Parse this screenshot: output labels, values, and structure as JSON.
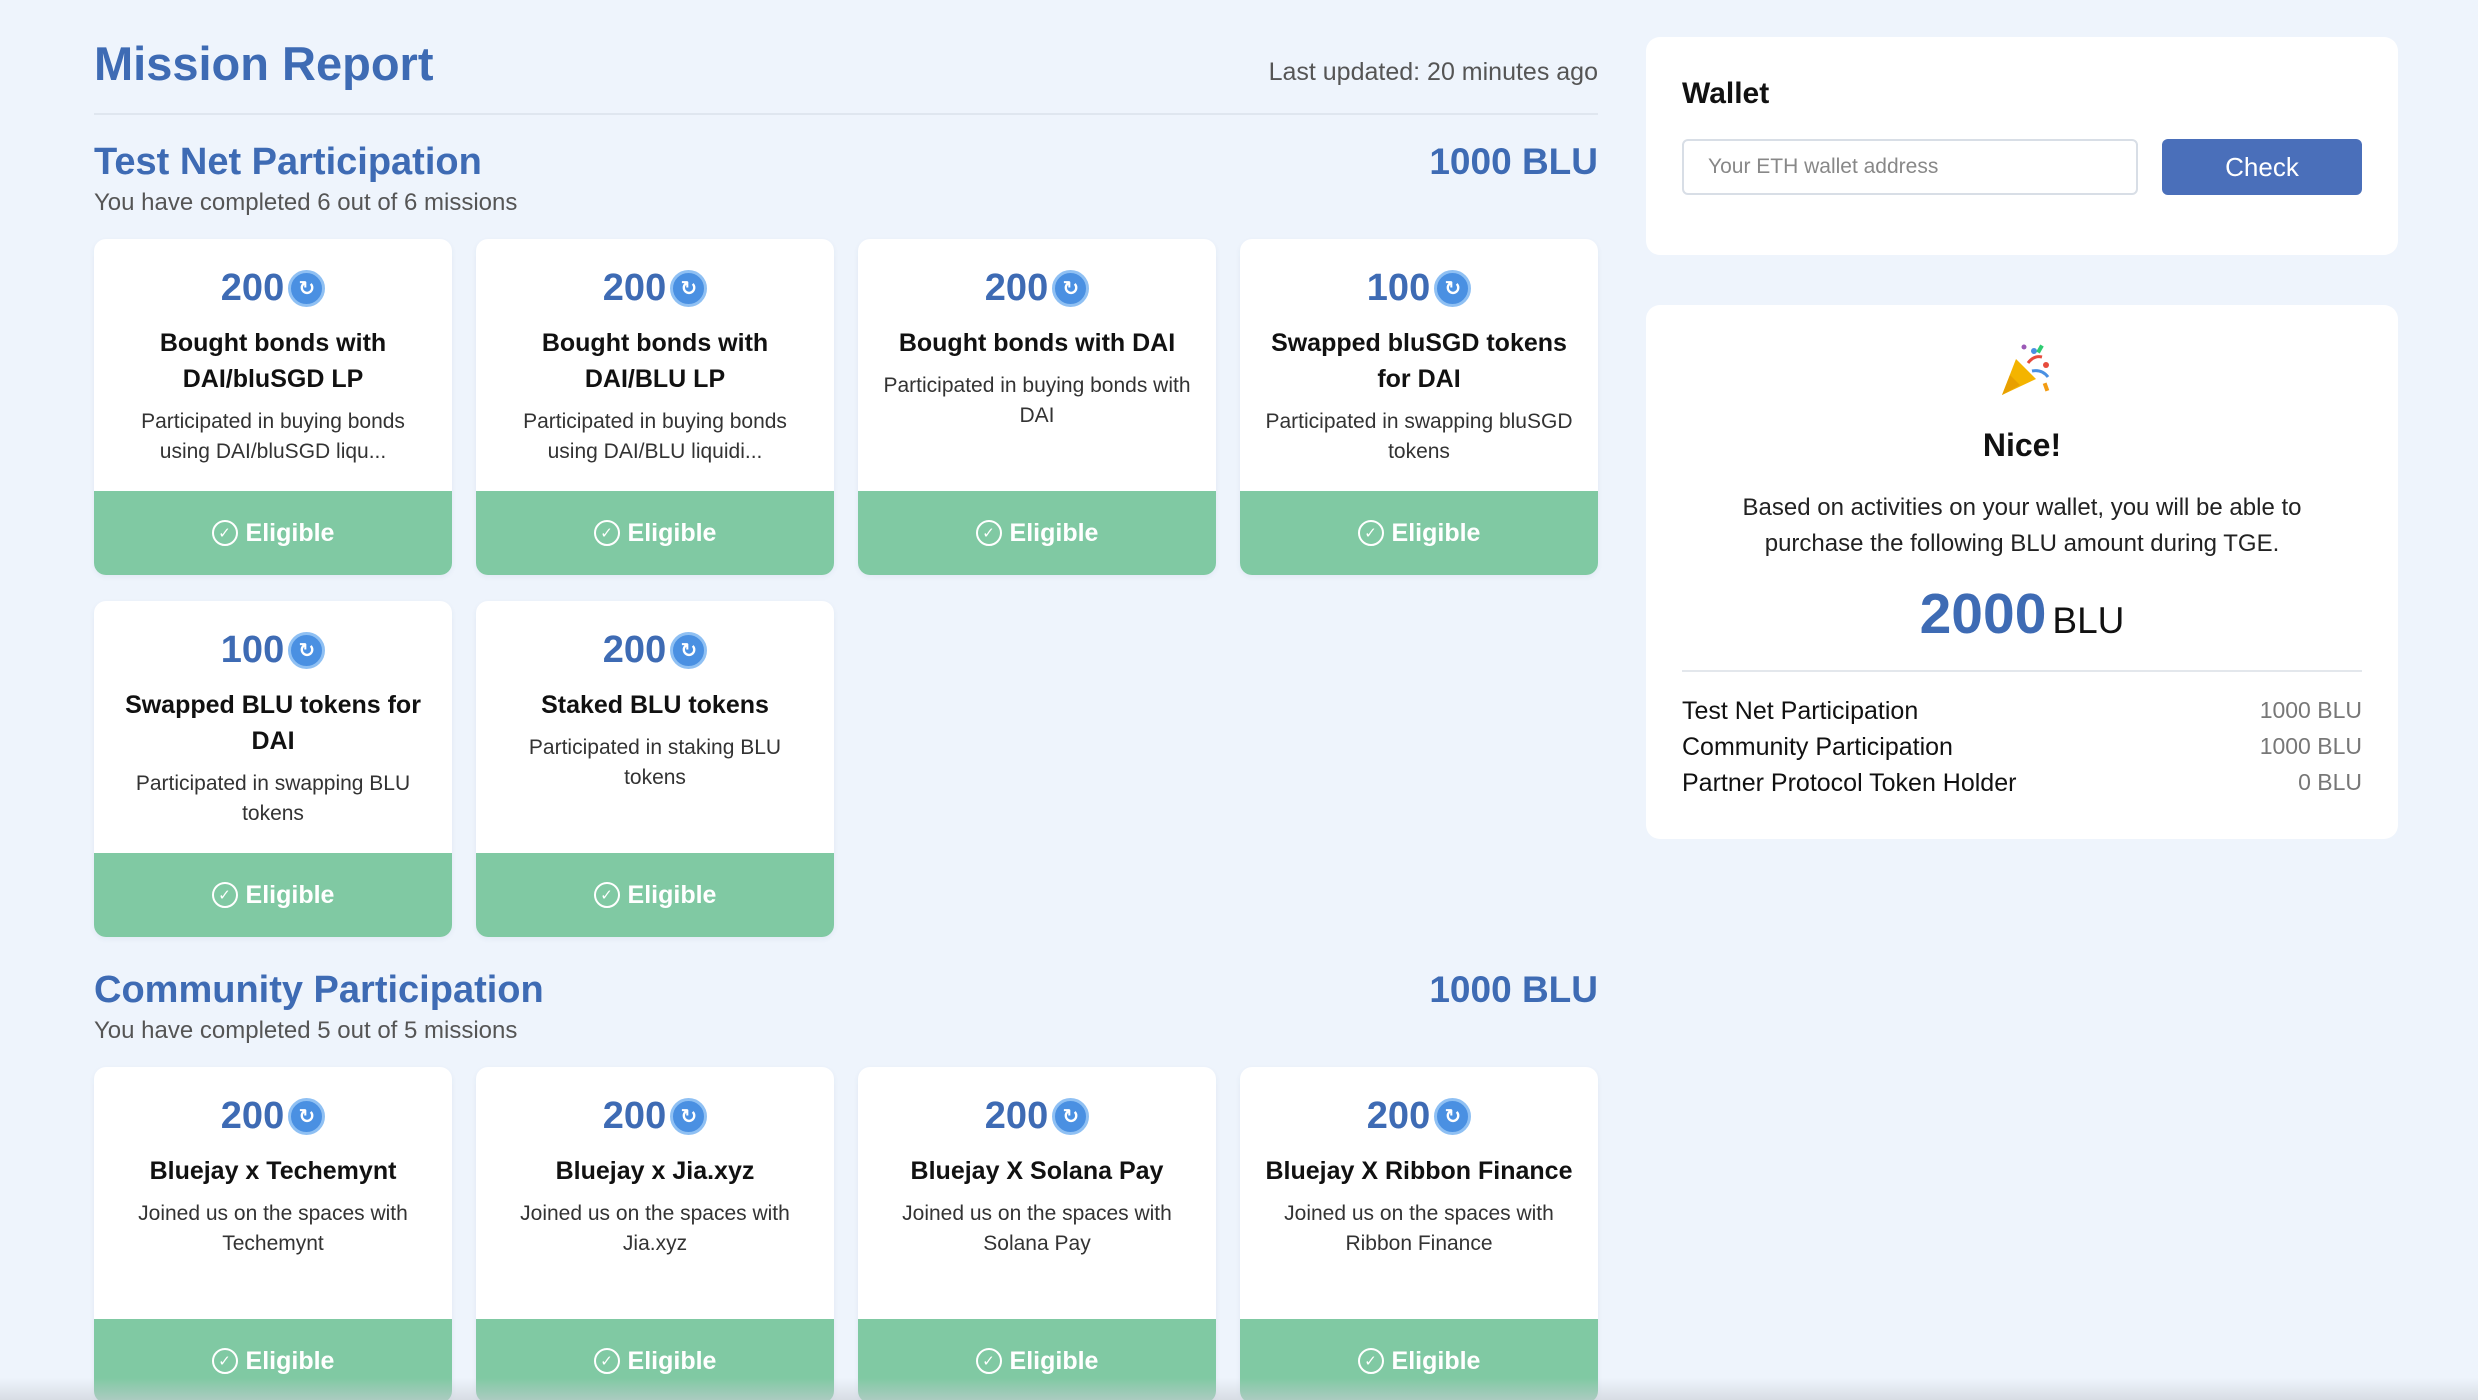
{
  "header": {
    "title": "Mission Report",
    "last_updated": "Last updated: 20 minutes ago"
  },
  "sections": [
    {
      "title": "Test Net Participation",
      "total": "1000 BLU",
      "subtitle": "You have completed 6 out of 6 missions",
      "missions": [
        {
          "points": "200",
          "title": "Bought bonds with DAI/bluSGD LP",
          "desc": "Participated in buying bonds using DAI/bluSGD liqu...",
          "status": "Eligible"
        },
        {
          "points": "200",
          "title": "Bought bonds with DAI/BLU LP",
          "desc": "Participated in buying bonds using DAI/BLU liquidi...",
          "status": "Eligible"
        },
        {
          "points": "200",
          "title": "Bought bonds with DAI",
          "desc": "Participated in buying bonds with DAI",
          "status": "Eligible"
        },
        {
          "points": "100",
          "title": "Swapped bluSGD tokens for DAI",
          "desc": "Participated in swapping bluSGD tokens",
          "status": "Eligible"
        },
        {
          "points": "100",
          "title": "Swapped BLU tokens for DAI",
          "desc": "Participated in swapping BLU tokens",
          "status": "Eligible"
        },
        {
          "points": "200",
          "title": "Staked BLU tokens",
          "desc": "Participated in staking BLU tokens",
          "status": "Eligible"
        }
      ]
    },
    {
      "title": "Community Participation",
      "total": "1000 BLU",
      "subtitle": "You have completed 5 out of 5 missions",
      "missions": [
        {
          "points": "200",
          "title": "Bluejay x Techemynt",
          "desc": "Joined us on the spaces with Techemynt",
          "status": "Eligible"
        },
        {
          "points": "200",
          "title": "Bluejay x Jia.xyz",
          "desc": "Joined us on the spaces with Jia.xyz",
          "status": "Eligible"
        },
        {
          "points": "200",
          "title": "Bluejay X Solana Pay",
          "desc": "Joined us on the spaces with Solana Pay",
          "status": "Eligible"
        },
        {
          "points": "200",
          "title": "Bluejay X Ribbon Finance",
          "desc": "Joined us on the spaces with Ribbon Finance",
          "status": "Eligible"
        }
      ]
    }
  ],
  "wallet": {
    "title": "Wallet",
    "placeholder": "Your ETH wallet address",
    "value": "",
    "button": "Check"
  },
  "result": {
    "icon": "party-popper-icon",
    "title": "Nice!",
    "description": "Based on activities on your wallet, you will be able to purchase the following BLU amount during TGE.",
    "amount": "2000",
    "unit": "BLU",
    "breakdown": [
      {
        "label": "Test Net Participation",
        "value": "1000 BLU"
      },
      {
        "label": "Community Participation",
        "value": "1000 BLU"
      },
      {
        "label": "Partner Protocol Token Holder",
        "value": "0 BLU"
      }
    ]
  },
  "colors": {
    "accent": "#3e6bb4",
    "eligible": "#80c9a3",
    "button": "#4a6fba",
    "background": "#eef4fc"
  }
}
